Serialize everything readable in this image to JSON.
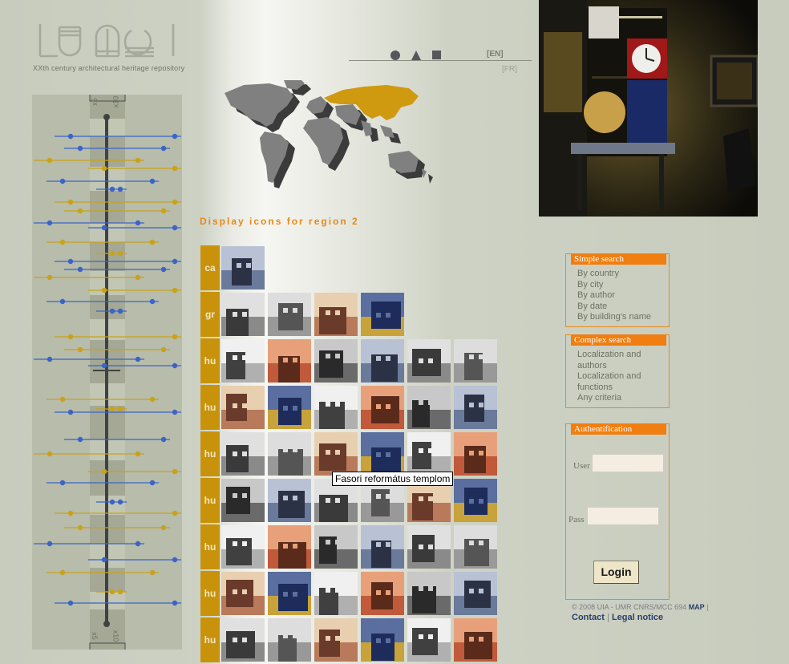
{
  "brand": {
    "logo_text": "LU MOI",
    "tagline": "XXth century architectural heritage repository"
  },
  "language": {
    "en": "[EN]",
    "fr": "[FR]"
  },
  "shapes": [
    "circle-icon",
    "triangle-icon",
    "square-icon"
  ],
  "region_title": "Display icons for region 2",
  "timeline": {
    "zoom_top": [
      "x5",
      "x10"
    ],
    "zoom_bottom": [
      "x5",
      "x10"
    ]
  },
  "grid_rows": [
    {
      "code": "ca",
      "thumbs": 1
    },
    {
      "code": "gr",
      "thumbs": 4
    },
    {
      "code": "hu",
      "thumbs": 6
    },
    {
      "code": "hu",
      "thumbs": 6
    },
    {
      "code": "hu",
      "thumbs": 6
    },
    {
      "code": "hu",
      "thumbs": 6
    },
    {
      "code": "hu",
      "thumbs": 6
    },
    {
      "code": "hu",
      "thumbs": 6
    },
    {
      "code": "hu",
      "thumbs": 6
    }
  ],
  "tooltip": "Fasori református templom",
  "simple_search": {
    "title": "Simple search",
    "links": [
      "By country",
      "By city",
      "By author",
      "By date",
      "By building's name"
    ]
  },
  "complex_search": {
    "title": "Complex search",
    "links": [
      "Localization and",
      "authors",
      "Localization and",
      "functions",
      "Any criteria"
    ]
  },
  "auth": {
    "title": "Authentification",
    "user_label": "User",
    "user_value": "",
    "pass_label": "Pass",
    "pass_value": "",
    "login_label": "Login"
  },
  "footer": {
    "copyright": "© 2008 UIA - UMR CNRS/MCC 694",
    "map": "MAP",
    "sep": "|",
    "contact": "Contact",
    "legal": "Legal notice"
  },
  "colors": {
    "accent": "#f07e10",
    "code_bg": "#c8930a",
    "region_highlight": "#cf9a10",
    "timeline_blue": "#3a64c8",
    "timeline_red": "#b01028",
    "timeline_gold": "#c9a218",
    "timeline_teal": "#1f8a8a"
  }
}
